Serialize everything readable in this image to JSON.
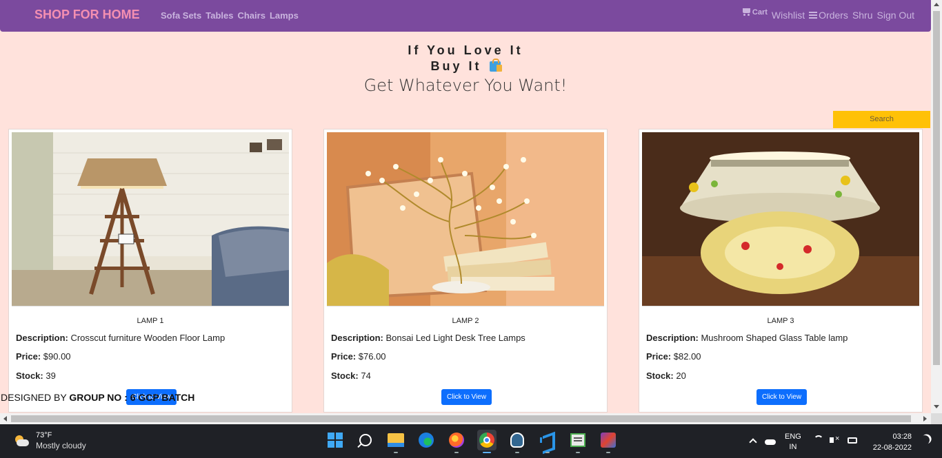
{
  "navbar": {
    "brand": "SHOP FOR HOME",
    "links": [
      "Sofa Sets",
      "Tables",
      "Chairs",
      "Lamps"
    ],
    "cart": "Cart",
    "wishlist": "Wishlist",
    "orders": "Orders",
    "user": "Shru",
    "signout": "Sign Out"
  },
  "hero": {
    "line1": "If You Love It",
    "line2": "Buy It",
    "line3": "Get Whatever You Want!"
  },
  "search": {
    "label": "Search"
  },
  "products": [
    {
      "title": "LAMP 1",
      "desc_label": "Description:",
      "desc": "Crosscut furniture Wooden Floor Lamp",
      "price_label": "Price:",
      "price": "$90.00",
      "stock_label": "Stock:",
      "stock": "39",
      "button": "Click to View"
    },
    {
      "title": "LAMP 2",
      "desc_label": "Description:",
      "desc": "Bonsai Led Light Desk Tree Lamps",
      "price_label": "Price:",
      "price": "$76.00",
      "stock_label": "Stock:",
      "stock": "74",
      "button": "Click to View"
    },
    {
      "title": "LAMP 3",
      "desc_label": "Description:",
      "desc": "Mushroom Shaped Glass Table lamp",
      "price_label": "Price:",
      "price": "$82.00",
      "stock_label": "Stock:",
      "stock": "20",
      "button": "Click to View"
    }
  ],
  "footer": {
    "prefix": "DESIGNED BY ",
    "group": "GROUP NO : 6 GCP BATCH"
  },
  "taskbar": {
    "temp": "73°F",
    "weather": "Mostly cloudy",
    "lang1": "ENG",
    "lang2": "IN",
    "time": "03:28",
    "date": "22-08-2022"
  },
  "colors": {
    "navbar": "#7b4a9e",
    "brand": "#f48fb1",
    "page_bg": "#ffe2dc",
    "search": "#ffc107",
    "button": "#0d6efd"
  }
}
